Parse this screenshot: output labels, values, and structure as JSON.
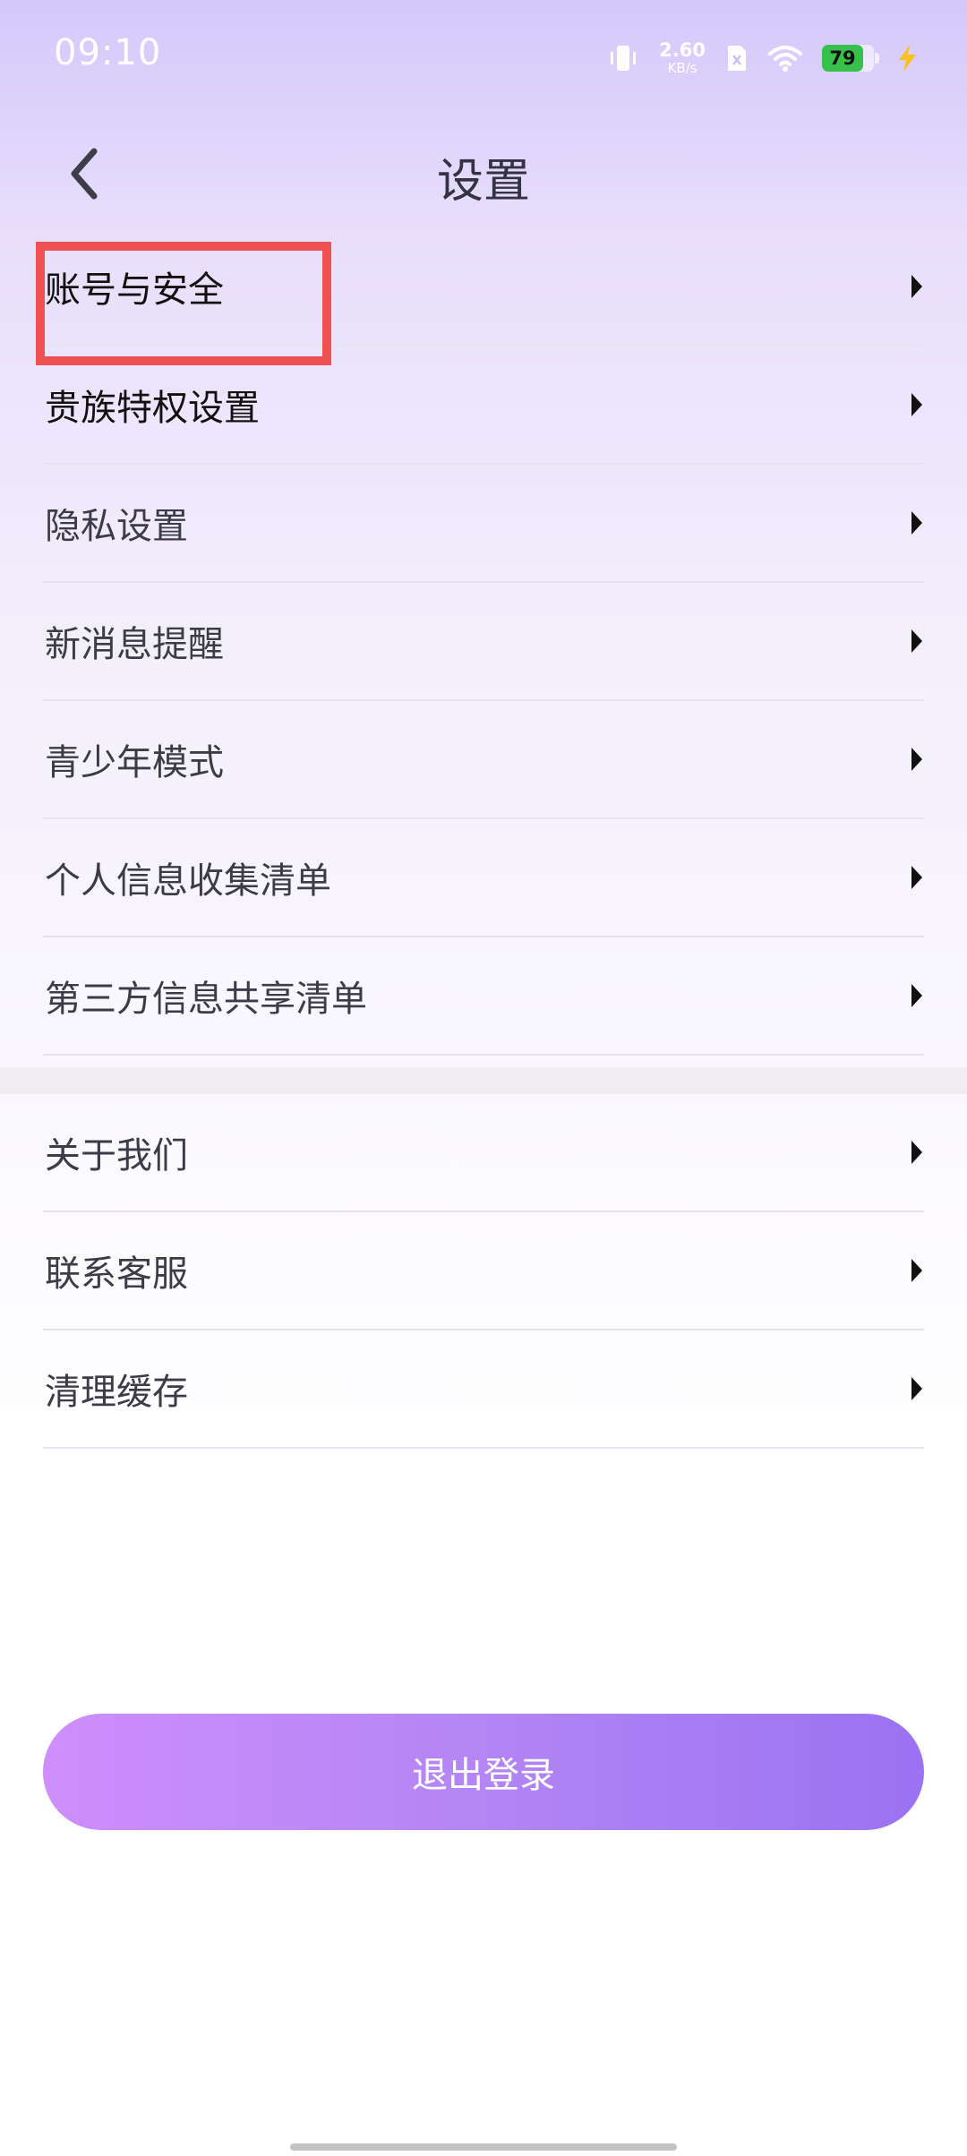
{
  "status_bar": {
    "time": "09:10",
    "net_speed_value": "2.60",
    "net_speed_unit": "KB/s",
    "battery_level": "79",
    "battery_fraction": 0.79,
    "icons": [
      "vibrate-icon",
      "sim-icon",
      "wifi-icon",
      "battery-icon",
      "charging-icon"
    ]
  },
  "header": {
    "title": "设置",
    "back_icon": "chevron-left-icon"
  },
  "menu": {
    "group1": [
      {
        "label": "账号与安全",
        "icon": "chevron-right-icon"
      },
      {
        "label": "贵族特权设置",
        "icon": "chevron-right-icon"
      },
      {
        "label": "隐私设置",
        "icon": "chevron-right-icon"
      },
      {
        "label": "新消息提醒",
        "icon": "chevron-right-icon"
      },
      {
        "label": "青少年模式",
        "icon": "chevron-right-icon"
      },
      {
        "label": "个人信息收集清单",
        "icon": "chevron-right-icon"
      },
      {
        "label": "第三方信息共享清单",
        "icon": "chevron-right-icon"
      }
    ],
    "group2": [
      {
        "label": "关于我们",
        "icon": "chevron-right-icon"
      },
      {
        "label": "联系客服",
        "icon": "chevron-right-icon"
      },
      {
        "label": "清理缓存",
        "icon": "chevron-right-icon"
      }
    ]
  },
  "logout": {
    "label": "退出登录"
  },
  "colors": {
    "accent_start": "#cf8efc",
    "accent_end": "#9a72f2",
    "highlight": "#ee5151",
    "battery": "#36c24a"
  }
}
